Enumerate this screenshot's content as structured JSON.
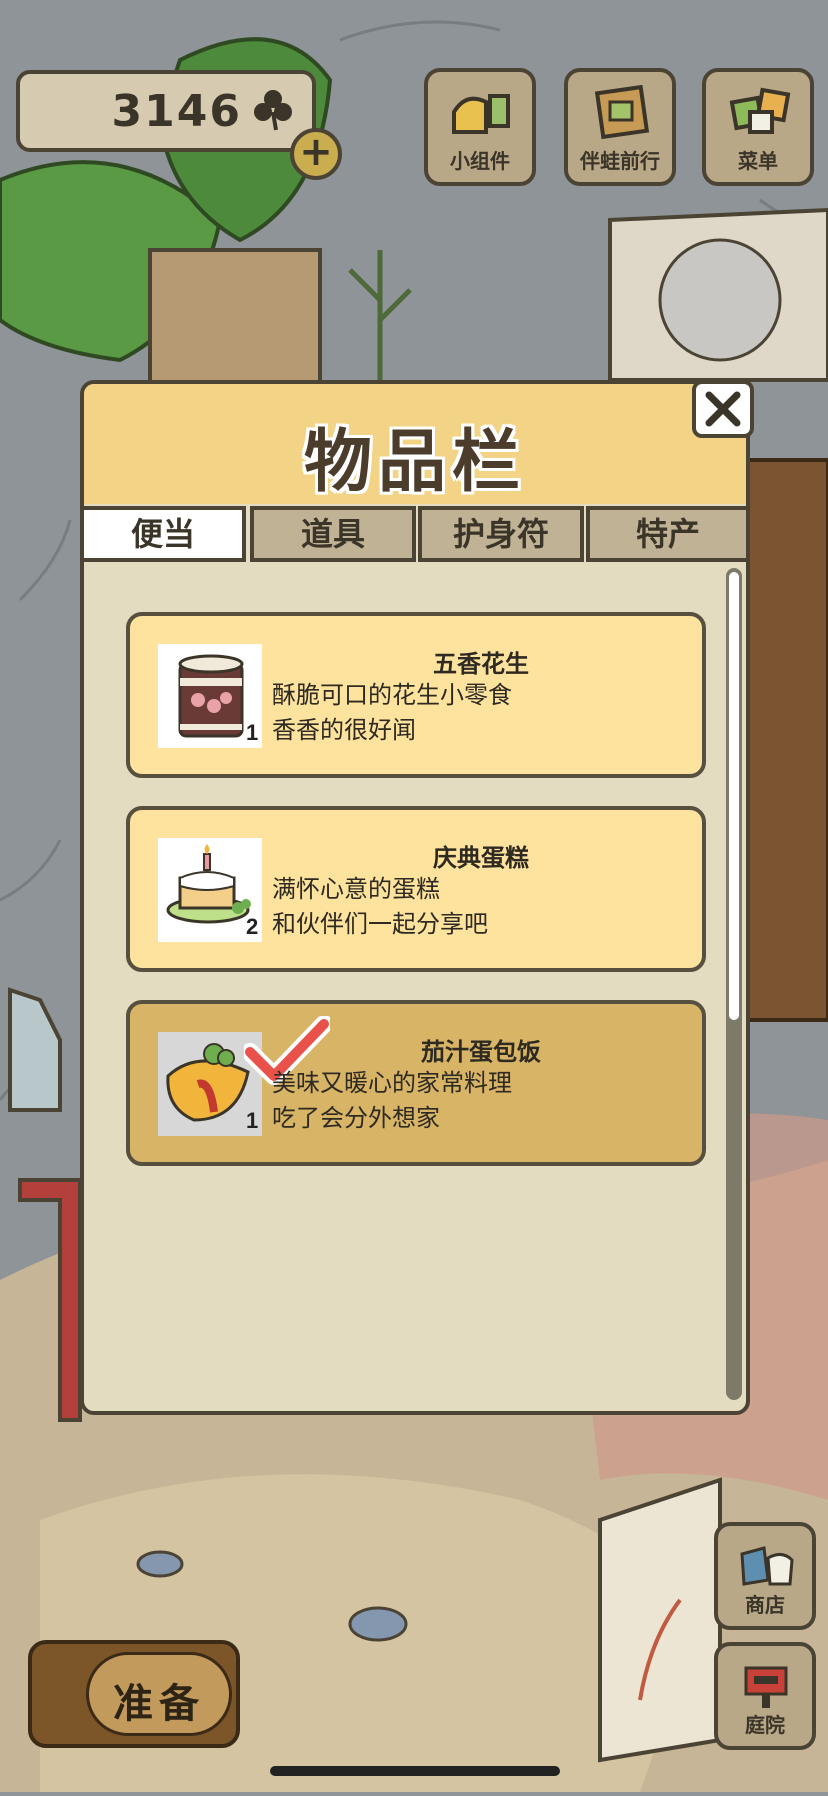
{
  "hud": {
    "clover_count": "3146",
    "buttons": [
      {
        "label": "小组件",
        "icon": "widget-icon"
      },
      {
        "label": "伴蛙前行",
        "icon": "frog-book-icon"
      },
      {
        "label": "菜单",
        "icon": "menu-cards-icon"
      }
    ]
  },
  "inventory": {
    "title": "物品栏",
    "tabs": [
      "便当",
      "道具",
      "护身符",
      "特产"
    ],
    "active_tab": "便当",
    "items": [
      {
        "name": "五香花生",
        "desc_line1": "酥脆可口的花生小零食",
        "desc_line2": "香香的很好闻",
        "qty": "1",
        "icon": "peanut-can-icon",
        "selected": false
      },
      {
        "name": "庆典蛋糕",
        "desc_line1": "满怀心意的蛋糕",
        "desc_line2": "和伙伴们一起分享吧",
        "qty": "2",
        "icon": "cake-icon",
        "selected": false
      },
      {
        "name": "茄汁蛋包饭",
        "desc_line1": "美味又暖心的家常料理",
        "desc_line2": "吃了会分外想家",
        "qty": "1",
        "icon": "omurice-icon",
        "selected": true
      }
    ]
  },
  "bottom": {
    "prepare_label": "准备",
    "shop_label": "商店",
    "yard_label": "庭院"
  },
  "colors": {
    "panel_header": "#f3d386",
    "item_bg": "#fde39e",
    "item_selected_bg": "#d7b466",
    "check_red": "#e8524a"
  }
}
